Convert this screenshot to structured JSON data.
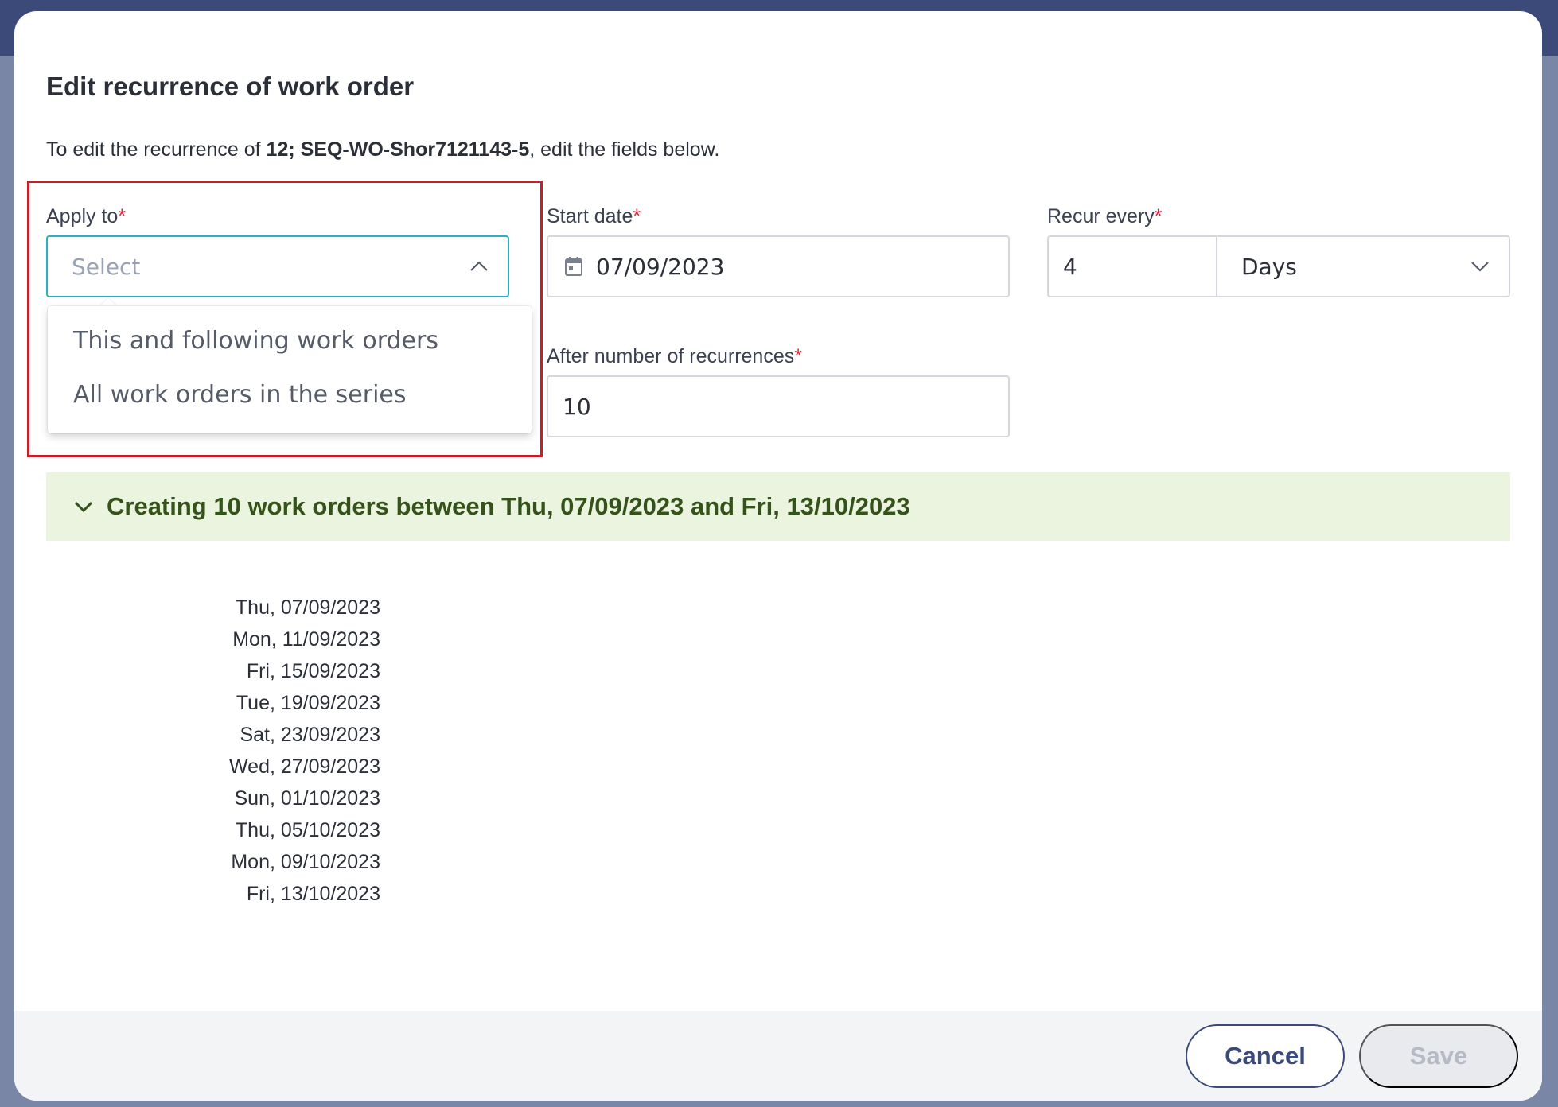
{
  "modal": {
    "title": "Edit recurrence of work order",
    "intro": {
      "prefix": "To edit the recurrence of ",
      "id": "12",
      "sep": "; ",
      "name": "SEQ-WO-Shor7121143-5",
      "suffix": ", edit the fields below."
    }
  },
  "apply_to": {
    "label": "Apply to",
    "required_mark": "*",
    "placeholder": "Select",
    "options": [
      "This and following work orders",
      "All work orders in the series"
    ]
  },
  "start_date": {
    "label": "Start date",
    "required_mark": "*",
    "value": "07/09/2023"
  },
  "recur_every": {
    "label": "Recur every",
    "required_mark": "*",
    "value": "4",
    "unit": "Days"
  },
  "after_recurrences": {
    "label": "After number of recurrences",
    "required_mark": "*",
    "value": "10"
  },
  "summary": {
    "text": "Creating 10 work orders between Thu, 07/09/2023 and Fri, 13/10/2023",
    "dates": [
      "Thu, 07/09/2023",
      "Mon, 11/09/2023",
      "Fri, 15/09/2023",
      "Tue, 19/09/2023",
      "Sat, 23/09/2023",
      "Wed, 27/09/2023",
      "Sun, 01/10/2023",
      "Thu, 05/10/2023",
      "Mon, 09/10/2023",
      "Fri, 13/10/2023"
    ]
  },
  "footer": {
    "cancel_label": "Cancel",
    "save_label": "Save"
  },
  "colors": {
    "accent_focus": "#2bb0bd",
    "required": "#d6283a",
    "banner_bg": "#eaf4de",
    "banner_text": "#35521a",
    "primary_outline": "#3a4a7a"
  }
}
